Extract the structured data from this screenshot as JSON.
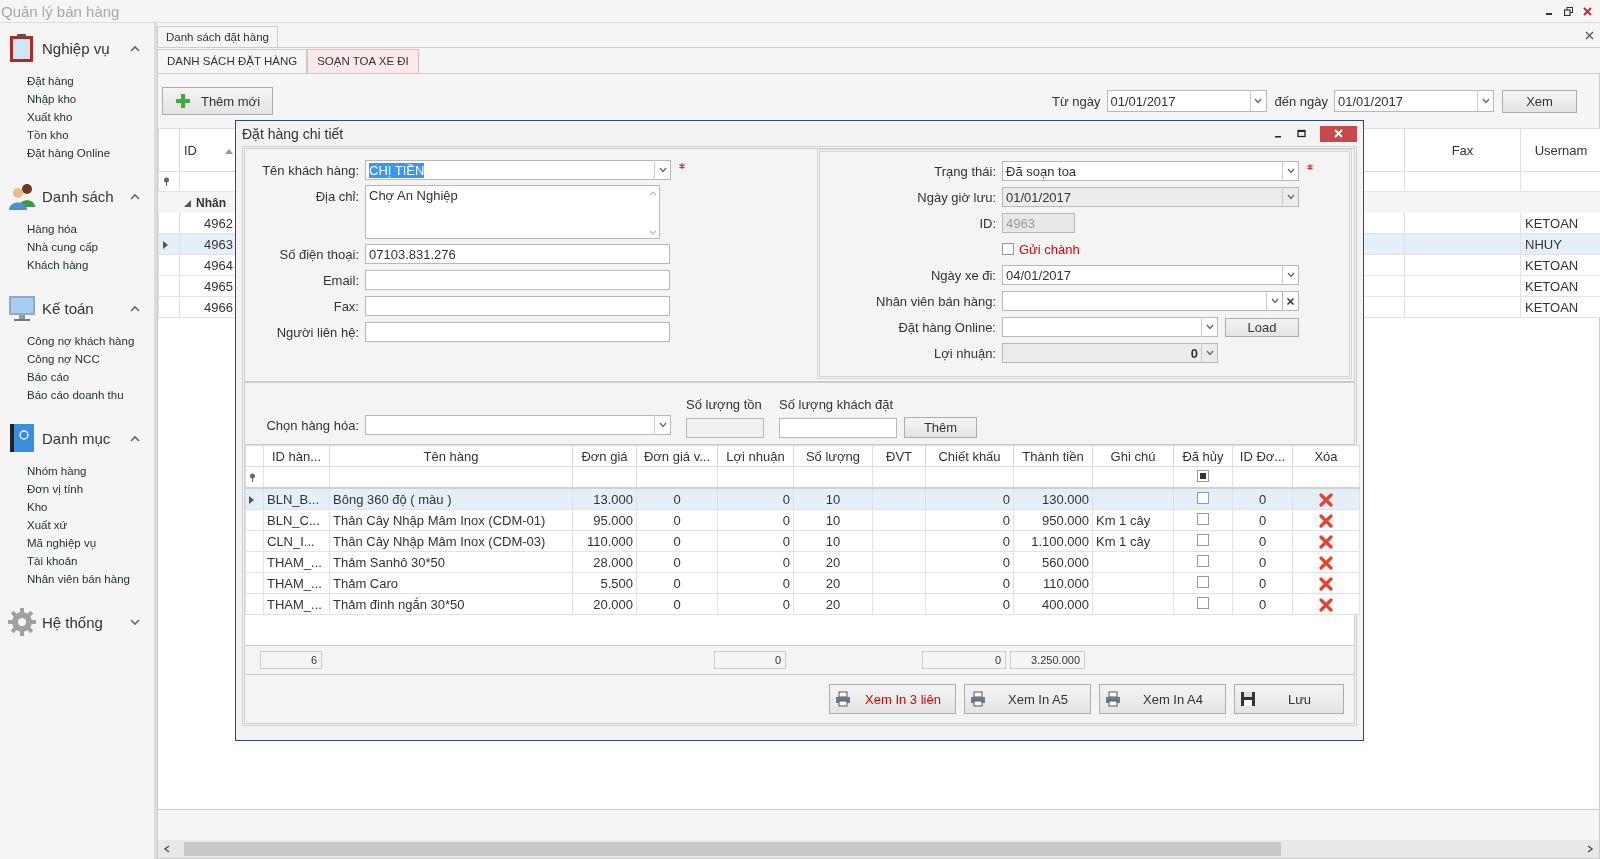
{
  "window": {
    "title": "Quản lý bán hàng"
  },
  "sidebar": {
    "groups": [
      {
        "title": "Nghiệp vụ",
        "expanded": true,
        "items": [
          "Đặt hàng",
          "Nhập kho",
          "Xuất kho",
          "Tồn kho",
          "Đặt hàng Online"
        ]
      },
      {
        "title": "Danh sách",
        "expanded": true,
        "items": [
          "Hàng hóa",
          "Nhà cung cấp",
          "Khách hàng"
        ]
      },
      {
        "title": "Kế toán",
        "expanded": true,
        "items": [
          "Công nợ khách hàng",
          "Công nợ NCC",
          "Báo cáo",
          "Báo cáo doanh thu"
        ]
      },
      {
        "title": "Danh mục",
        "expanded": true,
        "items": [
          "Nhóm hàng",
          "Đơn vị tính",
          "Kho",
          "Xuất xứ",
          "Mã nghiệp vụ",
          "Tài khoản",
          "Nhân viên bán hàng"
        ]
      },
      {
        "title": "Hệ thống",
        "expanded": false
      }
    ]
  },
  "document_tab": {
    "label": "Danh sách đặt hàng"
  },
  "tabs": [
    {
      "label": "DANH SÁCH ĐẶT HÀNG",
      "selected": true
    },
    {
      "label": "SOẠN TOA XE ĐI",
      "selected": false
    }
  ],
  "toolbar": {
    "add_button": "Thêm mới",
    "from_label": "Từ ngày",
    "from_date": "01/01/2017",
    "to_label": "đến ngày",
    "to_date": "01/01/2017",
    "view_button": "Xem"
  },
  "order_grid": {
    "columns": [
      {
        "label": "ID",
        "sorted": true
      },
      {
        "label": "Fax"
      },
      {
        "label": "Usernam"
      }
    ],
    "group": {
      "label": "Nhân",
      "expanded": true
    },
    "rows": [
      {
        "id": "4962",
        "username": "KETOAN",
        "selected": false
      },
      {
        "id": "4963",
        "username": "NHUY",
        "selected": true
      },
      {
        "id": "4964",
        "username": "KETOAN",
        "selected": false
      },
      {
        "id": "4965",
        "username": "KETOAN",
        "selected": false
      },
      {
        "id": "4966",
        "username": "KETOAN",
        "selected": false
      }
    ]
  },
  "dialog": {
    "title": "Đặt hàng chi tiết",
    "customer_fields": [
      {
        "kind": "combo",
        "label": "Tên khách hàng:",
        "value": "CHỊ TIỀN",
        "required": true,
        "highlighted": true
      },
      {
        "kind": "textarea",
        "label": "Địa chỉ:",
        "value": "Chợ An Nghiệp"
      },
      {
        "kind": "text",
        "label": "Số điện thoại:",
        "value": "07103.831.276"
      },
      {
        "kind": "text",
        "label": "Email:"
      },
      {
        "kind": "text",
        "label": "Fax:"
      },
      {
        "kind": "text",
        "label": "Người liên hệ:"
      }
    ],
    "order_fields": [
      {
        "kind": "combo",
        "label": "Trạng thái:",
        "value": "Đã soạn toa",
        "required": true
      },
      {
        "kind": "combo",
        "label": "Ngày giờ lưu:",
        "value": "01/01/2017",
        "disabled": true
      },
      {
        "kind": "short",
        "label": "ID:",
        "value": "4963",
        "disabled": true
      },
      {
        "kind": "checkbox",
        "label": "Gửi chành",
        "checked": false
      },
      {
        "kind": "combo",
        "label": "Ngày xe đi:",
        "value": "04/01/2017"
      },
      {
        "kind": "combo_clear",
        "label": "Nhân viên bán hàng:"
      },
      {
        "kind": "combo_button",
        "label": "Đặt hàng Online:",
        "button": "Load"
      },
      {
        "kind": "number_combo",
        "label": "Lợi nhuận:",
        "value": "0",
        "disabled": true
      }
    ],
    "picker": {
      "label": "Chọn hàng hóa:",
      "stock_label": "Số lượng tồn",
      "qty_label": "Số lượng khách đặt",
      "add_button": "Thêm"
    },
    "lines": {
      "columns": [
        {
          "label": "ID hàn...",
          "kind": "text",
          "summary": "6"
        },
        {
          "label": "Tên hàng",
          "kind": "text"
        },
        {
          "label": "Đơn giá",
          "kind": "num"
        },
        {
          "label": "Đơn giá v...",
          "kind": "center"
        },
        {
          "label": "Lợi nhuận",
          "kind": "num",
          "summary": "0"
        },
        {
          "label": "Số lượng",
          "kind": "center"
        },
        {
          "label": "ĐVT",
          "kind": "text"
        },
        {
          "label": "Chiết khấu",
          "kind": "num",
          "summary": "0"
        },
        {
          "label": "Thành tiền",
          "kind": "num",
          "summary": "3.250.000"
        },
        {
          "label": "Ghi chú",
          "kind": "text"
        },
        {
          "label": "Đã hủy",
          "kind": "check"
        },
        {
          "label": "ID Đơ...",
          "kind": "center"
        },
        {
          "label": "Xóa",
          "kind": "del"
        }
      ],
      "filter_cancelled_mixed": true,
      "rows": [
        {
          "selected": true,
          "id": "BLN_B...",
          "name": "Bông 360 độ ( màu )",
          "price": "13.000",
          "price_v": "0",
          "profit": "0",
          "qty": "10",
          "discount": "0",
          "total": "130.000",
          "cancelled": false,
          "order_id": "0"
        },
        {
          "selected": false,
          "id": "BLN_C...",
          "name": "Thân Cây Nhập Mâm Inox (CDM-01)",
          "price": "95.000",
          "price_v": "0",
          "profit": "0",
          "qty": "10",
          "discount": "0",
          "total": "950.000",
          "note": "Km 1 cây",
          "cancelled": false,
          "order_id": "0"
        },
        {
          "selected": false,
          "id": "CLN_I...",
          "name": "Thân Cây Nhập Mâm Inox (CDM-03)",
          "price": "110.000",
          "price_v": "0",
          "profit": "0",
          "qty": "10",
          "discount": "0",
          "total": "1.100.000",
          "note": "Km 1 cây",
          "cancelled": false,
          "order_id": "0"
        },
        {
          "selected": false,
          "id": "THAM_...",
          "name": "Thảm Sanhô 30*50",
          "price": "28.000",
          "price_v": "0",
          "profit": "0",
          "qty": "20",
          "discount": "0",
          "total": "560.000",
          "cancelled": false,
          "order_id": "0"
        },
        {
          "selected": false,
          "id": "THAM_...",
          "name": "Thảm Caro",
          "price": "5.500",
          "price_v": "0",
          "profit": "0",
          "qty": "20",
          "discount": "0",
          "total": "110.000",
          "cancelled": false,
          "order_id": "0"
        },
        {
          "selected": false,
          "id": "THAM_...",
          "name": "Thảm đinh ngắn 30*50",
          "price": "20.000",
          "price_v": "0",
          "profit": "0",
          "qty": "20",
          "discount": "0",
          "total": "400.000",
          "cancelled": false,
          "order_id": "0"
        }
      ]
    },
    "buttons": [
      {
        "label": "Xem In 3 liên",
        "accent": true
      },
      {
        "label": "Xem In A5",
        "accent": false
      },
      {
        "label": "Xem In A4",
        "accent": false
      },
      {
        "label": "Lưu",
        "kind": "save",
        "accent": false
      }
    ]
  }
}
